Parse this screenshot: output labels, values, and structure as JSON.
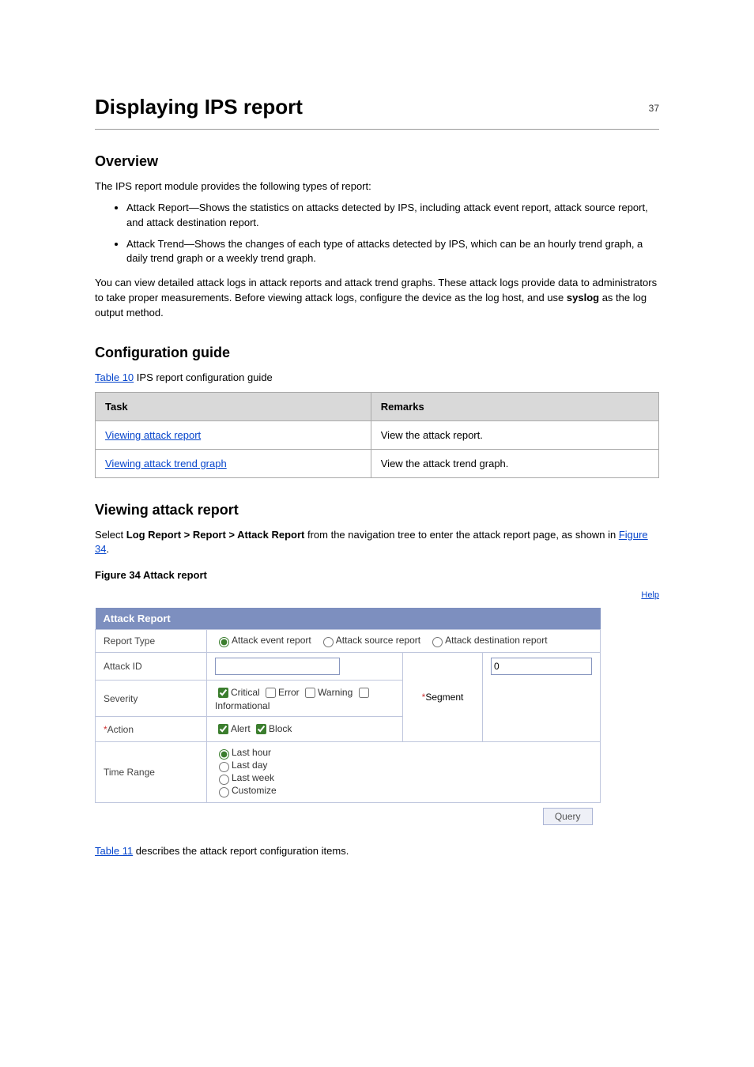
{
  "page_number": "37",
  "chapter": {
    "title": "Displaying IPS report"
  },
  "overview": {
    "heading": "Overview",
    "p1": "The IPS report module provides the following types of report:",
    "bullets": [
      "Attack Report—Shows the statistics on attacks detected by IPS, including attack event report, attack source report, and attack destination report.",
      "Attack Trend—Shows the changes of each type of attacks detected by IPS, which can be an hourly trend graph, a daily trend graph or a weekly trend graph."
    ],
    "p2_before": "You can view detailed attack logs in attack reports and attack trend graphs. These attack logs provide data to administrators to take proper measurements. Before viewing attack logs, configure the device as the log host, and use ",
    "p2_bold": "syslog",
    "p2_after": " as the log output method."
  },
  "config_guide": {
    "heading": "Configuration guide",
    "table_caption": "Table 10",
    "table_caption_text": "IPS report configuration guide",
    "task_col": "Task",
    "remarks_col": "Remarks",
    "rows": [
      {
        "task": "Viewing attack report",
        "remarks": "View the attack report."
      },
      {
        "task": "Viewing attack trend graph",
        "remarks": "View the attack trend graph."
      }
    ]
  },
  "viewing": {
    "heading": "Viewing attack report",
    "p_before": "Select ",
    "p_bold": "Log Report > Report > Attack Report",
    "p_after": " from the navigation tree to enter the attack report page, as shown in ",
    "p_figure_ref": "Figure 34",
    "p_period": ".",
    "figure_label": "Figure 34",
    "figure_text": "Attack report"
  },
  "attack_report_panel": {
    "help_link": "Help",
    "header": "Attack Report",
    "report_type_label": "Report Type",
    "report_type_options": [
      "Attack event report",
      "Attack source report",
      "Attack destination report"
    ],
    "report_type_selected": "Attack event report",
    "attack_id_label": "Attack ID",
    "attack_id_value": "",
    "severity_label": "Severity",
    "severity_options": [
      {
        "label": "Critical",
        "checked": true
      },
      {
        "label": "Error",
        "checked": false
      },
      {
        "label": "Warning",
        "checked": false
      },
      {
        "label": "Informational",
        "checked": false
      }
    ],
    "action_label": "Action",
    "action_options": [
      {
        "label": "Alert",
        "checked": true
      },
      {
        "label": "Block",
        "checked": true
      }
    ],
    "segment_label": "Segment",
    "segment_value": "0",
    "time_range_label": "Time Range",
    "time_range_options": [
      "Last hour",
      "Last day",
      "Last week",
      "Customize"
    ],
    "time_range_selected": "Last hour",
    "query_button": "Query"
  },
  "table_desc": {
    "table_label": "Table 11",
    "text": " describes the attack report configuration items."
  }
}
